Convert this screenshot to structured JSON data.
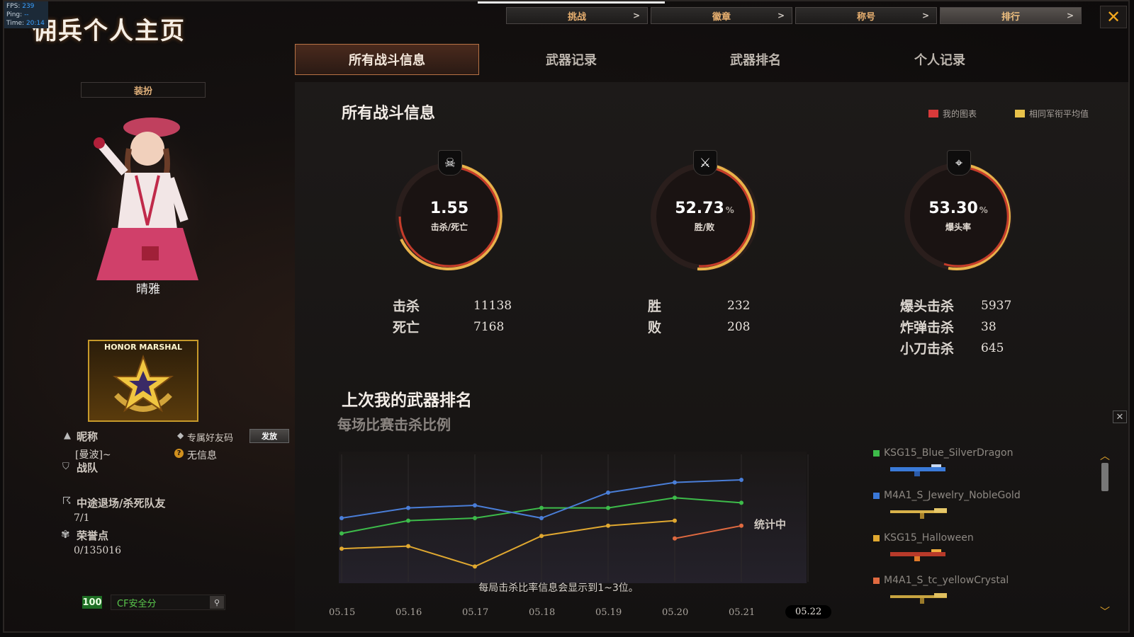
{
  "overlay": {
    "fps_label": "FPS:",
    "fps": "239",
    "ping_label": "Ping:",
    "ping": "--",
    "time_label": "Time:",
    "time": "20:14"
  },
  "page_title": "佣兵个人主页",
  "topbar": [
    {
      "label": "挑战"
    },
    {
      "label": "徽章"
    },
    {
      "label": "称号"
    },
    {
      "label": "排行"
    }
  ],
  "tabs": [
    {
      "label": "所有战斗信息"
    },
    {
      "label": "武器记录"
    },
    {
      "label": "武器排名"
    },
    {
      "label": "个人记录"
    }
  ],
  "costume_label": "装扮",
  "character_name": "晴雅",
  "badge_text": "HONOR MARSHAL",
  "profile": {
    "nickname_label": "昵称",
    "nickname": "[曼波]~",
    "friend_code_label": "专属好友码",
    "send_label": "发放",
    "no_info": "无信息",
    "team_label": "战队",
    "quit_label": "中途退场/杀死队友",
    "quit_value": "7/1",
    "honor_label": "荣誉点",
    "honor_value": "0/135016",
    "safety_score": "100",
    "safety_label": "CF安全分"
  },
  "battle": {
    "title": "所有战斗信息",
    "legend": [
      {
        "label": "我的图表",
        "color": "#d83a3a"
      },
      {
        "label": "相同军衔平均值",
        "color": "#e8c24a"
      }
    ],
    "dials": [
      {
        "value": "1.55",
        "pct": "",
        "label": "击杀/死亡",
        "icon": "skull-icon",
        "glyph": "☠"
      },
      {
        "value": "52.73",
        "pct": "%",
        "label": "胜/败",
        "icon": "crossed-swords-icon",
        "glyph": "⚔"
      },
      {
        "value": "53.30",
        "pct": "%",
        "label": "爆头率",
        "icon": "crosshair-icon",
        "glyph": "⌖"
      }
    ],
    "stats_kd": [
      {
        "label": "击杀",
        "value": "11138"
      },
      {
        "label": "死亡",
        "value": "7168"
      }
    ],
    "stats_wl": [
      {
        "label": "胜",
        "value": "232"
      },
      {
        "label": "败",
        "value": "208"
      }
    ],
    "stats_hs": [
      {
        "label": "爆头击杀",
        "value": "5937"
      },
      {
        "label": "炸弹击杀",
        "value": "38"
      },
      {
        "label": "小刀击杀",
        "value": "645"
      }
    ]
  },
  "weapon_rank": {
    "title": "上次我的武器排名",
    "subtitle": "每场比赛击杀比例",
    "counting": "统计中",
    "note": "每局击杀比率信息会显示到1~3位。",
    "weapons": [
      {
        "name": "KSG15_Blue_SilverDragon",
        "color": "#3dbb4a"
      },
      {
        "name": "M4A1_S_Jewelry_NobleGold",
        "color": "#3a78d8"
      },
      {
        "name": "KSG15_Halloween",
        "color": "#e0a830"
      },
      {
        "name": "M4A1_S_tc_yellowCrystal",
        "color": "#e06a40"
      }
    ]
  },
  "chart_data": {
    "type": "line",
    "categories": [
      "05.15",
      "05.16",
      "05.17",
      "05.18",
      "05.19",
      "05.20",
      "05.21",
      "05.22"
    ],
    "selected_category": "05.22",
    "ylim": [
      0,
      100
    ],
    "series": [
      {
        "name": "KSG15_Blue_SilverDragon",
        "color": "#3dbb4a",
        "values": [
          38,
          48,
          50,
          58,
          58,
          66,
          62,
          null
        ]
      },
      {
        "name": "M4A1_S_Jewelry_NobleGold",
        "color": "#4a7ed8",
        "values": [
          50,
          58,
          60,
          50,
          70,
          78,
          80,
          null
        ]
      },
      {
        "name": "KSG15_Halloween",
        "color": "#e0a830",
        "values": [
          26,
          28,
          12,
          36,
          44,
          48,
          null,
          null
        ]
      },
      {
        "name": "M4A1_S_tc_yellowCrystal",
        "color": "#e06a40",
        "values": [
          null,
          null,
          null,
          null,
          null,
          34,
          44,
          null
        ]
      }
    ]
  }
}
